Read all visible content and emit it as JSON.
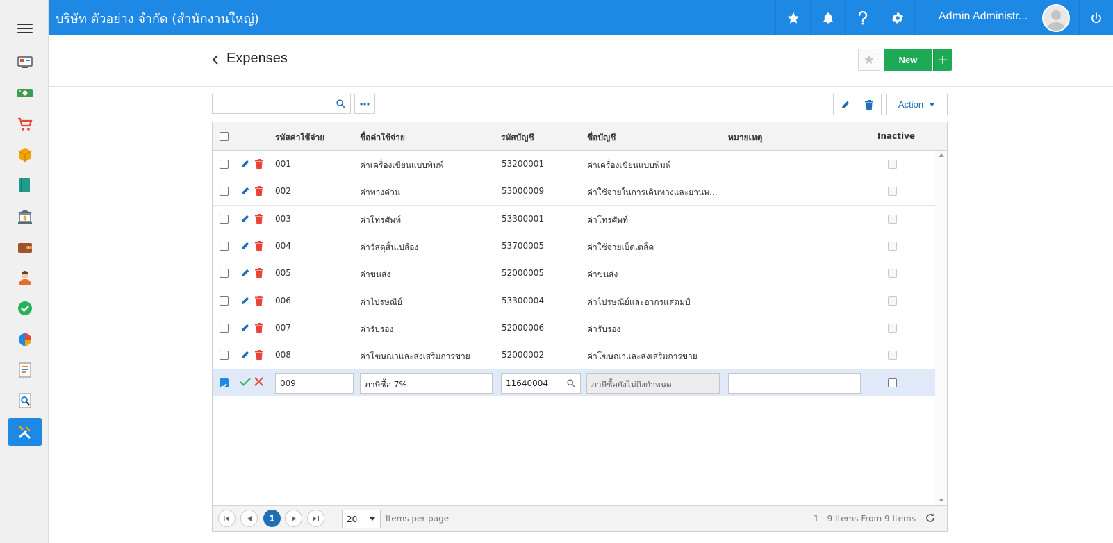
{
  "header": {
    "company": "บริษัท ตัวอย่าง จำกัด (สำนักงานใหญ่)",
    "user_name": "Admin Administr..."
  },
  "sidebar": {
    "items": [
      {
        "name": "dashboard-icon",
        "color": "#e14b3b"
      },
      {
        "name": "money-icon",
        "color": "#3c9b4e"
      },
      {
        "name": "cart-icon",
        "color": "#e94438"
      },
      {
        "name": "box-icon",
        "color": "#f0a500"
      },
      {
        "name": "book-icon",
        "color": "#1f9d8b"
      },
      {
        "name": "bank-icon",
        "color": "#5b6b7c"
      },
      {
        "name": "wallet-icon",
        "color": "#a0522d"
      },
      {
        "name": "people-icon",
        "color": "#e66b2e"
      },
      {
        "name": "check-icon",
        "color": "#24b35b"
      },
      {
        "name": "pie-chart-icon",
        "color": "#e94438"
      },
      {
        "name": "report-icon",
        "color": "#e68a2e"
      },
      {
        "name": "search-doc-icon",
        "color": "#1e88e5"
      },
      {
        "name": "tools-icon",
        "color": "#f0a500"
      }
    ]
  },
  "page": {
    "title": "Expenses",
    "new_label": "New",
    "new_plus": "+",
    "action_label": "Action"
  },
  "table": {
    "headers": {
      "code": "รหัสค่าใช้จ่าย",
      "name": "ชื่อค่าใช้จ่าย",
      "account_code": "รหัสบัญชี",
      "account_name": "ชื่อบัญชี",
      "note": "หมายเหตุ",
      "inactive": "Inactive"
    },
    "rows": [
      {
        "code": "001",
        "name": "ค่าเครื่องเขียนแบบพิมพ์",
        "account_code": "53200001",
        "account_name": "ค่าเครื่องเขียนแบบพิมพ์",
        "note": ""
      },
      {
        "code": "002",
        "name": "ค่าทางด่วน",
        "account_code": "53000009",
        "account_name": "ค่าใช้จ่ายในการเดินทางและยานพ...",
        "note": ""
      },
      {
        "code": "003",
        "name": "ค่าโทรศัพท์",
        "account_code": "53300001",
        "account_name": "ค่าโทรศัพท์",
        "note": ""
      },
      {
        "code": "004",
        "name": "ค่าวัสดุสิ้นเปลือง",
        "account_code": "53700005",
        "account_name": "ค่าใช้จ่ายเบ็ดเตล็ด",
        "note": ""
      },
      {
        "code": "005",
        "name": "ค่าขนส่ง",
        "account_code": "52000005",
        "account_name": "ค่าขนส่ง",
        "note": ""
      },
      {
        "code": "006",
        "name": "ค่าไปรษณีย์",
        "account_code": "53300004",
        "account_name": "ค่าไปรษณีย์และอากรแสตมป์",
        "note": ""
      },
      {
        "code": "007",
        "name": "ค่ารับรอง",
        "account_code": "52000006",
        "account_name": "ค่ารับรอง",
        "note": ""
      },
      {
        "code": "008",
        "name": "ค่าโฆษณาและส่งเสริมการขาย",
        "account_code": "52000002",
        "account_name": "ค่าโฆษณาและส่งเสริมการขาย",
        "note": ""
      }
    ],
    "edit_row": {
      "code": "009",
      "name": "ภาษีซื้อ 7%",
      "account_code": "11640004",
      "account_name": "ภาษีซื้อยังไม่ถึงกำหนด",
      "note": ""
    }
  },
  "pager": {
    "current_page": "1",
    "page_size": "20",
    "per_page_label": "Items per page",
    "info": "1 - 9 Items From 9 Items"
  }
}
